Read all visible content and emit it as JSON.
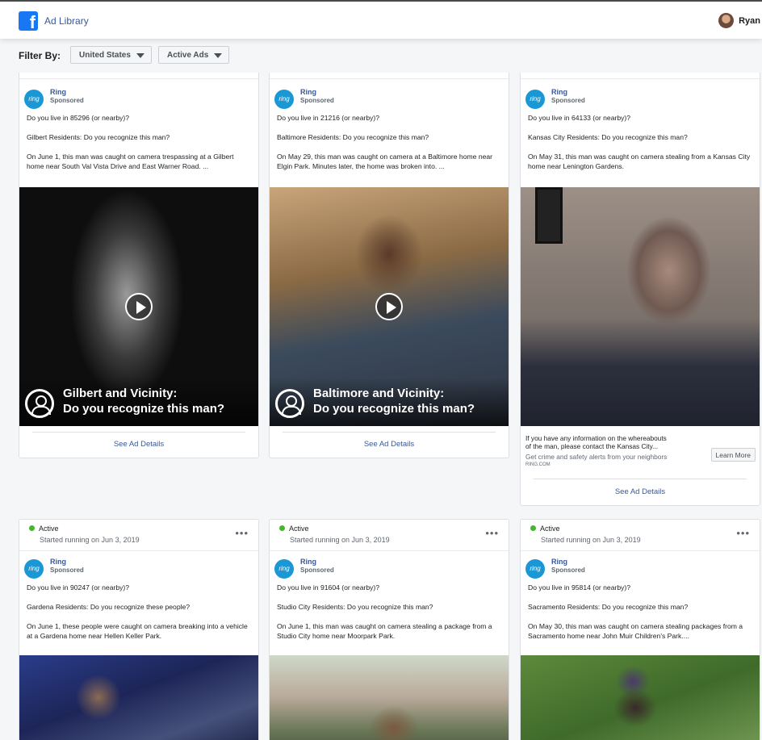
{
  "header": {
    "logo_glyph": "f",
    "title": "Ad Library",
    "user_name": "Ryan"
  },
  "filters": {
    "label": "Filter By:",
    "country": "United States",
    "ad_status": "Active Ads"
  },
  "common": {
    "status": "Active",
    "started": "Started running on Jun 3, 2019",
    "advertiser": "Ring",
    "sponsored": "Sponsored",
    "ring_logo": "ring",
    "see_details": "See Ad Details",
    "more": "•••"
  },
  "cards": [
    {
      "zip": "Do you live in 85296 (or nearby)?",
      "headline": "Gilbert Residents: Do you recognize this man?",
      "body": "On June 1, this man was caught on camera trespassing at a Gilbert home near South Val Vista Drive and East Warner Road. ...",
      "overlay_line1": "Gilbert and Vicinity:",
      "overlay_line2": "Do you recognize this man?"
    },
    {
      "zip": "Do you live in 21216 (or nearby)?",
      "headline": "Baltimore Residents: Do you recognize this man?",
      "body": "On May 29, this man was caught on camera at a Baltimore home near Elgin Park. Minutes later, the home was broken into. ...",
      "overlay_line1": "Baltimore and Vicinity:",
      "overlay_line2": "Do you recognize this man?"
    },
    {
      "zip": "Do you live in 64133 (or nearby)?",
      "headline": "Kansas City Residents: Do you recognize this man?",
      "body": "On May 31, this man was caught on camera stealing from a Kansas City home near Lenington Gardens.",
      "cta_line1": "If you have any information on the whereabouts",
      "cta_line2": "of the man, please contact the Kansas City...",
      "cta_sub": "Get crime and safety alerts from your neighbors",
      "cta_domain": "RING.COM",
      "cta_button": "Learn More"
    },
    {
      "zip": "Do you live in 90247 (or nearby)?",
      "headline": "Gardena Residents: Do you recognize these people?",
      "body": "On June 1, these people were caught on camera breaking into a vehicle at a Gardena home near Hellen Keller Park."
    },
    {
      "zip": "Do you live in 91604 (or nearby)?",
      "headline": "Studio City Residents: Do you recognize this man?",
      "body": "On June 1, this man was caught on camera stealing a package from a Studio City home near Moorpark Park."
    },
    {
      "zip": "Do you live in 95814 (or nearby)?",
      "headline": "Sacramento Residents: Do you recognize this man?",
      "body": "On May 30, this man was caught on camera stealing packages from a Sacramento home near John Muir Children's Park...."
    }
  ],
  "colors": {
    "facebook_blue": "#1877f2",
    "link_blue": "#385898",
    "ring_blue": "#1a98d5",
    "active_green": "#42b72a"
  }
}
